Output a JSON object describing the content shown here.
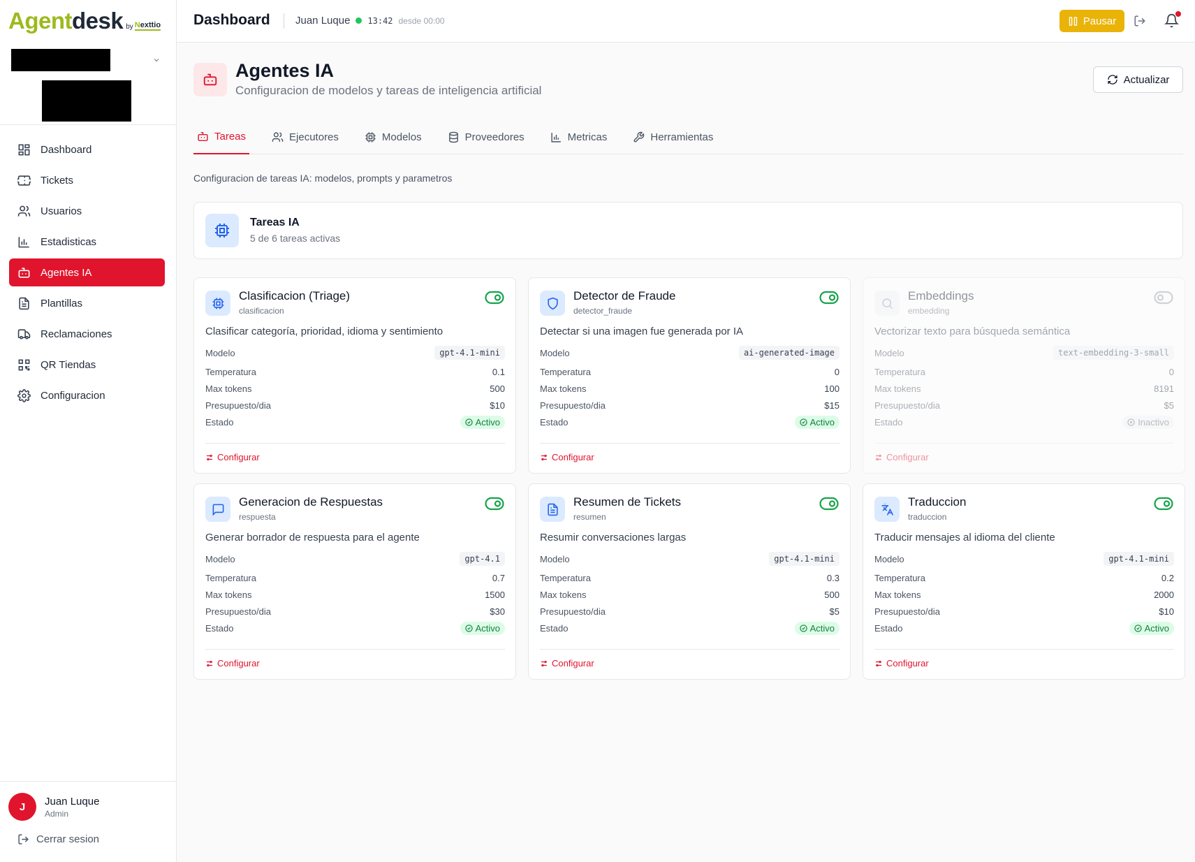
{
  "brand": {
    "name_a": "Agent",
    "name_b": "desk",
    "by": "by",
    "partner_a": "N",
    "partner_b": "exttio"
  },
  "sidebar": {
    "items": [
      {
        "label": "Dashboard",
        "icon": "dashboard-icon"
      },
      {
        "label": "Tickets",
        "icon": "ticket-icon"
      },
      {
        "label": "Usuarios",
        "icon": "users-icon"
      },
      {
        "label": "Estadisticas",
        "icon": "bar-chart-icon"
      },
      {
        "label": "Agentes IA",
        "icon": "bot-icon",
        "active": true
      },
      {
        "label": "Plantillas",
        "icon": "file-text-icon"
      },
      {
        "label": "Reclamaciones",
        "icon": "truck-icon"
      },
      {
        "label": "QR Tiendas",
        "icon": "qr-code-icon"
      },
      {
        "label": "Configuracion",
        "icon": "settings-icon"
      }
    ],
    "user": {
      "initial": "J",
      "name": "Juan Luque",
      "role": "Admin"
    },
    "logout": "Cerrar sesion"
  },
  "header": {
    "title": "Dashboard",
    "user": "Juan Luque",
    "time": "13:42",
    "since": "desde 00:00",
    "pause": "Pausar"
  },
  "page": {
    "title": "Agentes IA",
    "subtitle": "Configuracion de modelos y tareas de inteligencia artificial",
    "refresh": "Actualizar",
    "tabs": [
      {
        "label": "Tareas",
        "icon": "bot-icon",
        "active": true
      },
      {
        "label": "Ejecutores",
        "icon": "users-icon"
      },
      {
        "label": "Modelos",
        "icon": "cpu-icon"
      },
      {
        "label": "Proveedores",
        "icon": "database-icon"
      },
      {
        "label": "Metricas",
        "icon": "bar-chart-icon"
      },
      {
        "label": "Herramientas",
        "icon": "wrench-icon"
      }
    ],
    "description": "Configuracion de tareas IA: modelos, prompts y parametros",
    "summary": {
      "title": "Tareas IA",
      "subtitle": "5 de 6 tareas activas"
    }
  },
  "labels": {
    "model": "Modelo",
    "temperature": "Temperatura",
    "max_tokens": "Max tokens",
    "budget": "Presupuesto/dia",
    "status": "Estado",
    "configure": "Configurar"
  },
  "tasks": [
    {
      "name": "Clasificacion (Triage)",
      "slug": "clasificacion",
      "description": "Clasificar categoría, prioridad, idioma y sentimiento",
      "model": "gpt-4.1-mini",
      "temperature": "0.1",
      "max_tokens": "500",
      "budget": "$10",
      "status": "Activo",
      "enabled": true,
      "icon": "cpu-icon"
    },
    {
      "name": "Detector de Fraude",
      "slug": "detector_fraude",
      "description": "Detectar si una imagen fue generada por IA",
      "model": "ai-generated-image",
      "temperature": "0",
      "max_tokens": "100",
      "budget": "$15",
      "status": "Activo",
      "enabled": true,
      "icon": "shield-icon"
    },
    {
      "name": "Embeddings",
      "slug": "embedding",
      "description": "Vectorizar texto para búsqueda semántica",
      "model": "text-embedding-3-small",
      "temperature": "0",
      "max_tokens": "8191",
      "budget": "$5",
      "status": "Inactivo",
      "enabled": false,
      "icon": "search-icon"
    },
    {
      "name": "Generacion de Respuestas",
      "slug": "respuesta",
      "description": "Generar borrador de respuesta para el agente",
      "model": "gpt-4.1",
      "temperature": "0.7",
      "max_tokens": "1500",
      "budget": "$30",
      "status": "Activo",
      "enabled": true,
      "icon": "message-square-icon"
    },
    {
      "name": "Resumen de Tickets",
      "slug": "resumen",
      "description": "Resumir conversaciones largas",
      "model": "gpt-4.1-mini",
      "temperature": "0.3",
      "max_tokens": "500",
      "budget": "$5",
      "status": "Activo",
      "enabled": true,
      "icon": "file-text-icon"
    },
    {
      "name": "Traduccion",
      "slug": "traduccion",
      "description": "Traducir mensajes al idioma del cliente",
      "model": "gpt-4.1-mini",
      "temperature": "0.2",
      "max_tokens": "2000",
      "budget": "$10",
      "status": "Activo",
      "enabled": true,
      "icon": "languages-icon"
    }
  ],
  "colors": {
    "accent": "#e0142d",
    "brand_green": "#9db91d",
    "pause": "#eab308",
    "active_green": "#16a34a",
    "task_icon_bg": "#dbeafe"
  }
}
